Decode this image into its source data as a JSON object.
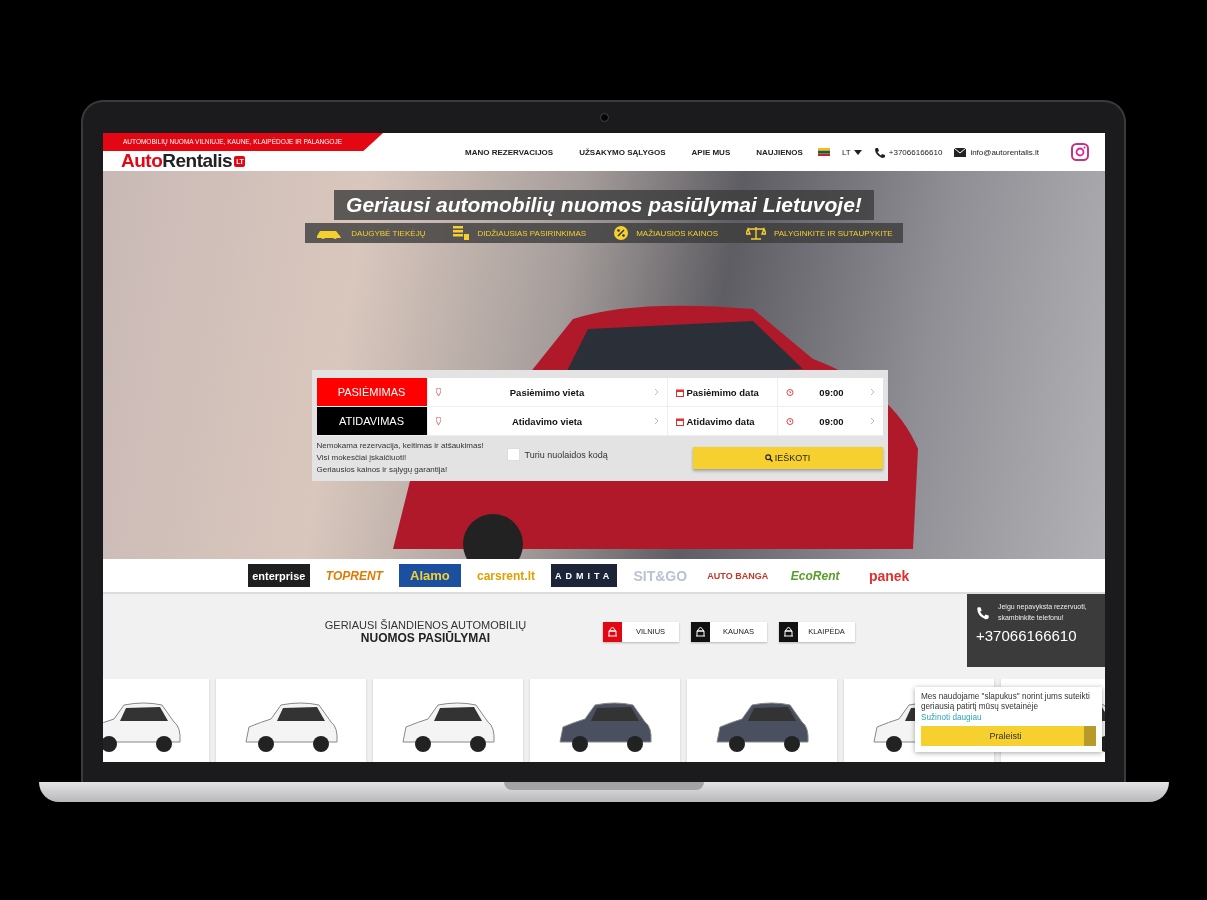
{
  "header": {
    "tagline": "AUTOMOBILIŲ NUOMA VILNIUJE, KAUNE, KLAIPĖDOJE IR PALANGOJE",
    "logo": {
      "main": "Auto",
      "accent": "Rentalis",
      "badge": "LT"
    },
    "nav": [
      "MANO REZERVACIJOS",
      "UŽSAKYMO SĄLYGOS",
      "APIE MUS",
      "NAUJIENOS"
    ],
    "language": "LT",
    "phone": "+37066166610",
    "email": "info@autorentalis.lt"
  },
  "hero": {
    "title": "Geriausi automobilių nuomos pasiūlymai Lietuvoje!",
    "features": [
      {
        "kind": "car",
        "label": "DAUGYBĖ TIEKĖJŲ"
      },
      {
        "kind": "list",
        "label": "DIDŽIAUSIAS PASIRINKIMAS"
      },
      {
        "kind": "percent",
        "label": "MAŽIAUSIOS KAINOS"
      },
      {
        "kind": "scale",
        "label": "PALYGINKITE IR SUTAUPYKITE"
      }
    ]
  },
  "search": {
    "rows": [
      {
        "kind": "pickup",
        "label": "PASIĖMIMAS",
        "location": "Pasiėmimo vieta",
        "date": "Pasiėmimo data",
        "time": "09:00"
      },
      {
        "kind": "return",
        "label": "ATIDAVIMAS",
        "location": "Atidavimo vieta",
        "date": "Atidavimo data",
        "time": "09:00"
      }
    ],
    "notes": [
      "Nemokama rezervacija, keitimas ir atšaukimas!",
      "Visi mokesčiai įskaičiuoti!",
      "Geriausios kainos ir sąlygų garantija!"
    ],
    "discount": {
      "label": "Turiu nuolaidos kodą",
      "checked": false
    },
    "button": "IEŠKOTI"
  },
  "brands": [
    {
      "kind": "enterprise",
      "name": "enterprise"
    },
    {
      "kind": "toprent",
      "name": "TOPRENT"
    },
    {
      "kind": "alamo",
      "name": "Alamo"
    },
    {
      "kind": "cars",
      "name": "carsrent.lt"
    },
    {
      "kind": "admita",
      "name": "ADMITA"
    },
    {
      "kind": "sitgo",
      "name": "SIT&GO"
    },
    {
      "kind": "banga",
      "name": "AUTO BANGA"
    },
    {
      "kind": "ecorent",
      "name": "EcoRent"
    },
    {
      "kind": "panek",
      "name": "panek"
    }
  ],
  "offers": {
    "title": "GERIAUSI ŠIANDIENOS AUTOMOBILIŲ",
    "subtitle": "NUOMOS PASIŪLYMAI",
    "cities": [
      {
        "name": "VILNIUS",
        "selected": true
      },
      {
        "name": "KAUNAS",
        "selected": false
      },
      {
        "name": "KLAIPĖDA",
        "selected": false
      }
    ]
  },
  "call_box": {
    "text": "Jeigu nepavyksta rezervuoti, skambinkite telefonu!",
    "phone": "+37066166610"
  },
  "cookie": {
    "text": "Mes naudojame \"slapukus\" norint jums suteikti geriausią patirtį mūsų svetainėje",
    "link": "Sužinoti daugiau",
    "button": "Praleisti"
  }
}
